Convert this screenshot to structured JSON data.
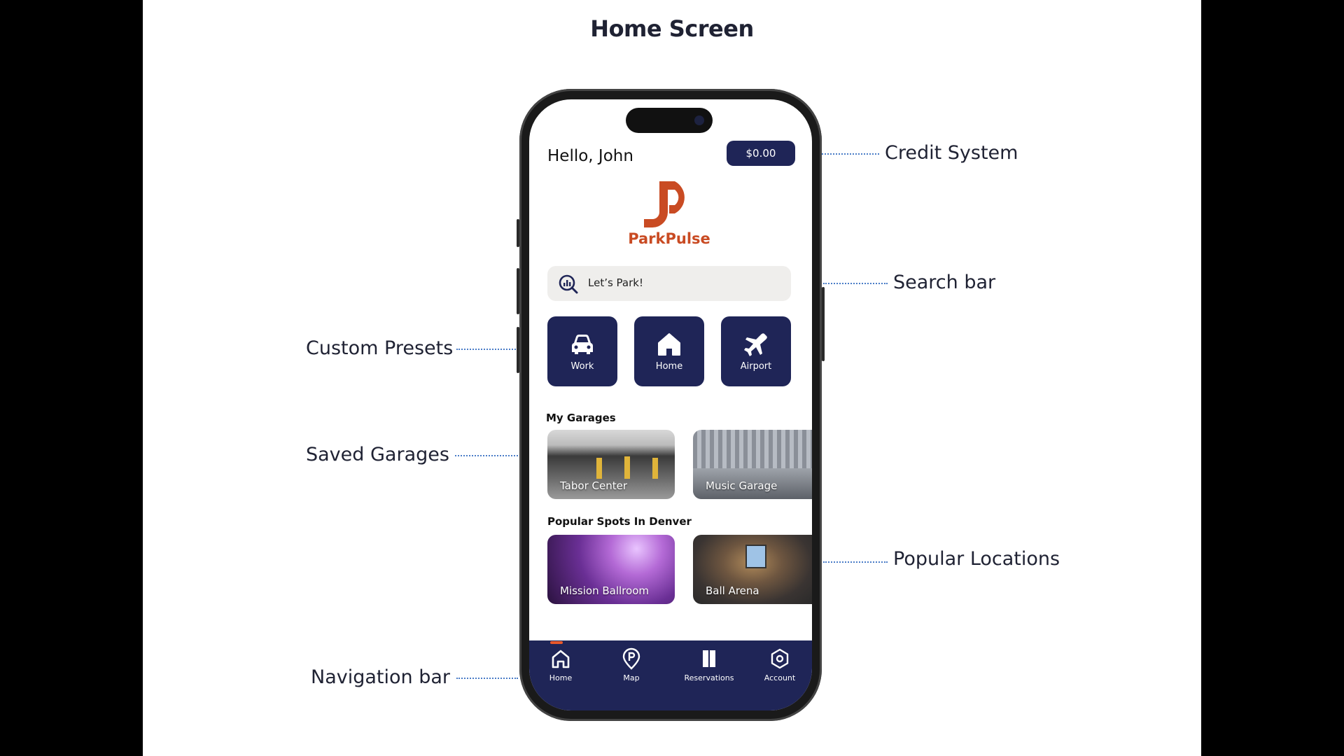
{
  "page": {
    "title": "Home Screen"
  },
  "annotations": {
    "credit_system": "Credit System",
    "search_bar": "Search bar",
    "custom_presets": "Custom Presets",
    "saved_garages": "Saved Garages",
    "popular_locations": "Popular Locations",
    "navigation_bar": "Navigation bar"
  },
  "app": {
    "greeting": "Hello, John",
    "credit_balance": "$0.00",
    "brand_name": "ParkPulse",
    "search": {
      "placeholder": "Let’s Park!",
      "icon": "search-icon"
    },
    "presets": [
      {
        "label": "Work",
        "icon": "car-icon"
      },
      {
        "label": "Home",
        "icon": "house-icon"
      },
      {
        "label": "Airport",
        "icon": "airplane-icon"
      }
    ],
    "my_garages": {
      "heading": "My Garages",
      "items": [
        {
          "name": "Tabor Center"
        },
        {
          "name": "Music Garage"
        }
      ]
    },
    "popular": {
      "heading": "Popular Spots In Denver",
      "items": [
        {
          "name": "Mission Ballroom"
        },
        {
          "name": "Ball Arena"
        }
      ]
    },
    "tabs": [
      {
        "label": "Home",
        "icon": "house-icon",
        "active": true
      },
      {
        "label": "Map",
        "icon": "parking-pin-icon"
      },
      {
        "label": "Reservations",
        "icon": "reservations-icon"
      },
      {
        "label": "Account",
        "icon": "hexagon-account-icon"
      }
    ]
  },
  "colors": {
    "navy": "#1f2557",
    "brand_orange": "#c94b23",
    "accent_orange": "#e8582b",
    "annotation_line": "#4a7cc7"
  }
}
